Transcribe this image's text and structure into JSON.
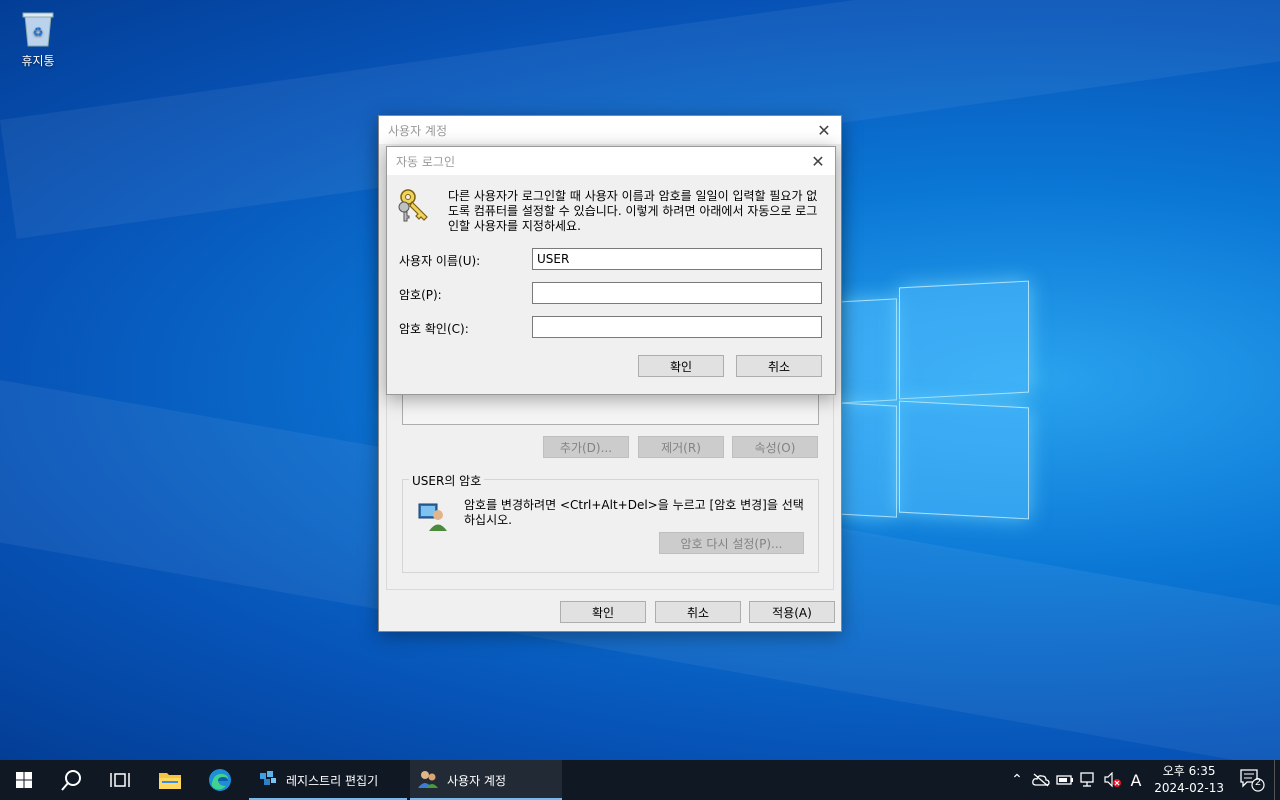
{
  "desktop": {
    "recycle_bin_label": "휴지통"
  },
  "outer_dialog": {
    "title": "사용자 계정",
    "list_buttons": {
      "add": "추가(D)...",
      "remove": "제거(R)",
      "properties": "속성(O)"
    },
    "password_group": {
      "title": "USER의 암호",
      "text": "암호를 변경하려면 <Ctrl+Alt+Del>을 누르고 [암호 변경]을 선택하십시오.",
      "reset_button": "암호 다시 설정(P)..."
    },
    "footer": {
      "ok": "확인",
      "cancel": "취소",
      "apply": "적용(A)"
    }
  },
  "auto_login_dialog": {
    "title": "자동 로그인",
    "description": "다른 사용자가 로그인할 때 사용자 이름과 암호를 일일이 입력할 필요가 없도록 컴퓨터를 설정할 수 있습니다. 이렇게 하려면 아래에서 자동으로 로그인할 사용자를 지정하세요.",
    "username_label": "사용자 이름(U):",
    "username_value": "USER",
    "password_label": "암호(P):",
    "password_value": "",
    "confirm_label": "암호 확인(C):",
    "confirm_value": "",
    "ok": "확인",
    "cancel": "취소"
  },
  "taskbar": {
    "apps": [
      {
        "label": "레지스트리 편집기",
        "icon": "registry-editor-icon"
      },
      {
        "label": "사용자 계정",
        "icon": "user-accounts-icon"
      }
    ],
    "input_indicator": "A",
    "clock_time": "오후 6:35",
    "clock_date": "2024-02-13",
    "notification_count": "2"
  },
  "colors": {
    "desktop": "#0b78d6",
    "taskbar": "#101824",
    "accent": "#0078d7"
  }
}
